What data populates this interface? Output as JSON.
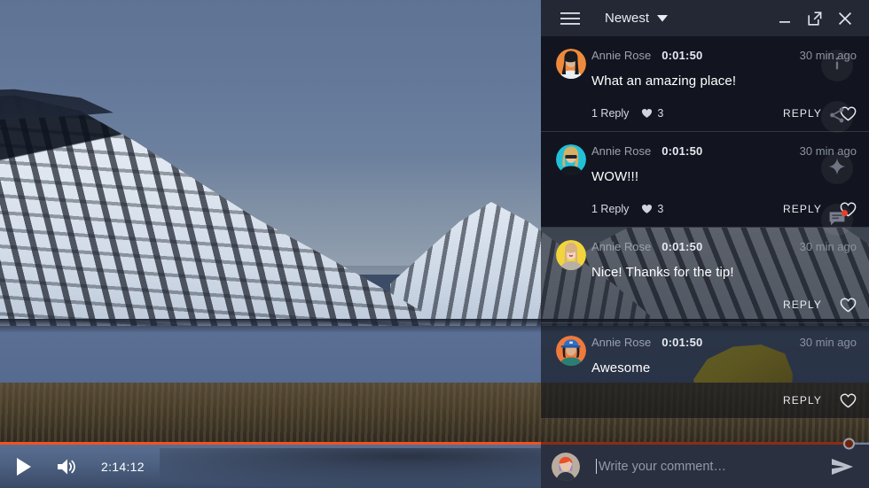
{
  "player": {
    "time_display": "2:14:12",
    "play_icon": "play-icon",
    "volume_icon": "volume-icon",
    "progress_percent": 100,
    "scene_description": "snowy fjord mountains with yellow tent"
  },
  "panel": {
    "header": {
      "menu_icon": "hamburger-menu-icon",
      "sort_label": "Newest",
      "sort_caret_icon": "chevron-down-icon",
      "minimize_label": "minimize-icon",
      "popout_label": "pop-out-icon",
      "close_label": "close-icon"
    },
    "overlay_rail": [
      {
        "icon": "info-icon",
        "badge": false
      },
      {
        "icon": "share-icon",
        "badge": false
      },
      {
        "icon": "sparkle-icon",
        "badge": false
      },
      {
        "icon": "comment-icon",
        "badge": true
      }
    ],
    "scroll_progress_percent": 95,
    "comments": [
      {
        "author": "Annie Rose",
        "timestamp": "0:01:50",
        "age": "30 min ago",
        "text": "What an amazing place!",
        "replies": "1 Reply",
        "likes": "3",
        "reply_label": "REPLY",
        "like_icon": "heart-outline-icon",
        "avatar_color": "#ef8a3c",
        "avatar_style": "dark-long-hair",
        "show_engagement": true,
        "background": "opaque"
      },
      {
        "author": "Annie Rose",
        "timestamp": "0:01:50",
        "age": "30 min ago",
        "text": "WOW!!!",
        "replies": "1 Reply",
        "likes": "3",
        "reply_label": "REPLY",
        "like_icon": "heart-outline-icon",
        "avatar_color": "#22c0d8",
        "avatar_style": "sunglasses-blonde",
        "show_engagement": true,
        "background": "opaque"
      },
      {
        "author": "Annie Rose",
        "timestamp": "0:01:50",
        "age": "30 min ago",
        "text": "Nice! Thanks for the tip!",
        "replies": "",
        "likes": "",
        "reply_label": "REPLY",
        "like_icon": "heart-outline-icon",
        "avatar_color": "#f2d43c",
        "avatar_style": "pale-portrait",
        "show_engagement": false,
        "background": "translucent"
      },
      {
        "author": "Annie Rose",
        "timestamp": "0:01:50",
        "age": "30 min ago",
        "text": "Awesome",
        "replies": "",
        "likes": "",
        "reply_label": "REPLY",
        "like_icon": "heart-outline-icon",
        "avatar_color": "#f0793c",
        "avatar_style": "blue-cap",
        "show_engagement": false,
        "background": "translucent"
      }
    ],
    "composer": {
      "placeholder": "Write your comment…",
      "value": "",
      "send_icon": "send-icon",
      "avatar_color": "#c8b8a8",
      "avatar_style": "red-hair"
    }
  },
  "colors": {
    "accent": "#f4511e",
    "header_bg": "#242834",
    "panel_bg": "#12151f",
    "composer_bg": "#2b3040",
    "badge": "#e8402a",
    "text_primary": "#ffffff",
    "text_muted": "#8b92a0"
  }
}
